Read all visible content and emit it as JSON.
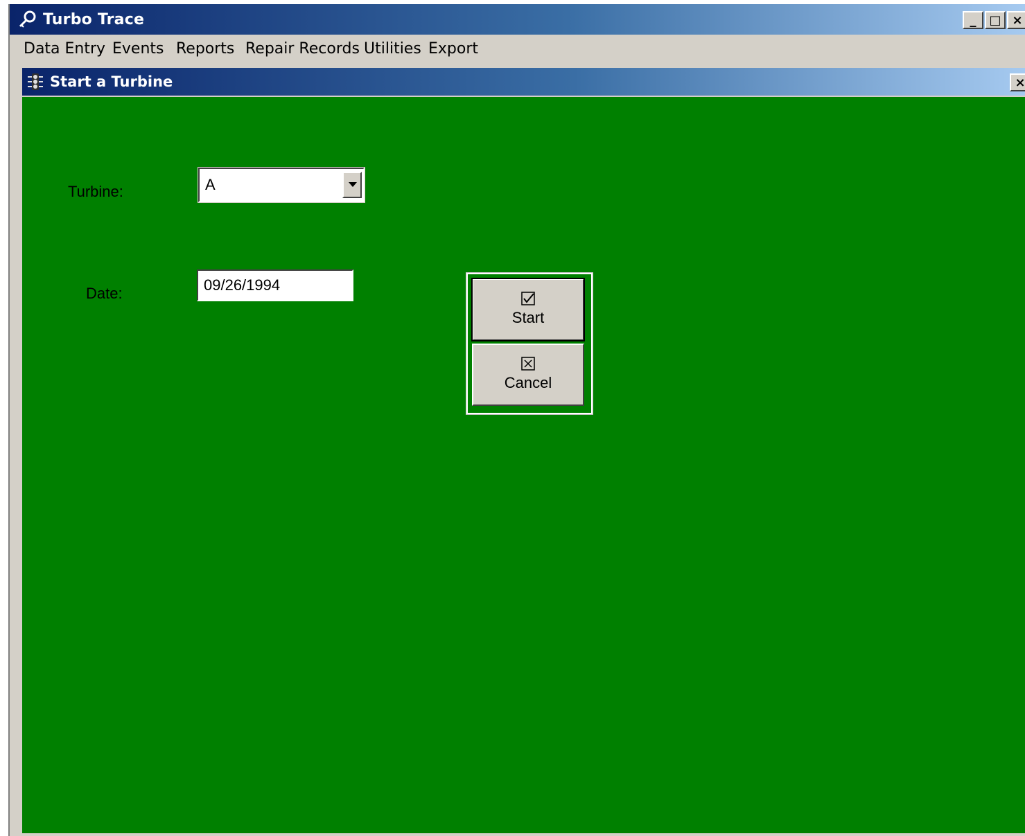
{
  "app": {
    "title": "Turbo Trace",
    "window_buttons": {
      "minimize": "_",
      "maximize": "□",
      "close": "×"
    }
  },
  "menu": {
    "items": [
      "Data Entry",
      "Events",
      "Reports",
      "Repair Records",
      "Utilities",
      "Export"
    ]
  },
  "child_window": {
    "title": "Start a Turbine",
    "close": "×",
    "background": "#008000"
  },
  "form": {
    "turbine_label": "Turbine:",
    "turbine_value": "A",
    "date_label": "Date:",
    "date_value": "09/26/1994"
  },
  "buttons": {
    "start_label": "Start",
    "cancel_label": "Cancel",
    "start_icon": "checkbox-check-icon",
    "cancel_icon": "checkbox-x-icon"
  },
  "colors": {
    "titlebar_start": "#0a246a",
    "titlebar_end": "#a6caf0",
    "form_background": "#008000",
    "chrome": "#d4d0c8"
  }
}
